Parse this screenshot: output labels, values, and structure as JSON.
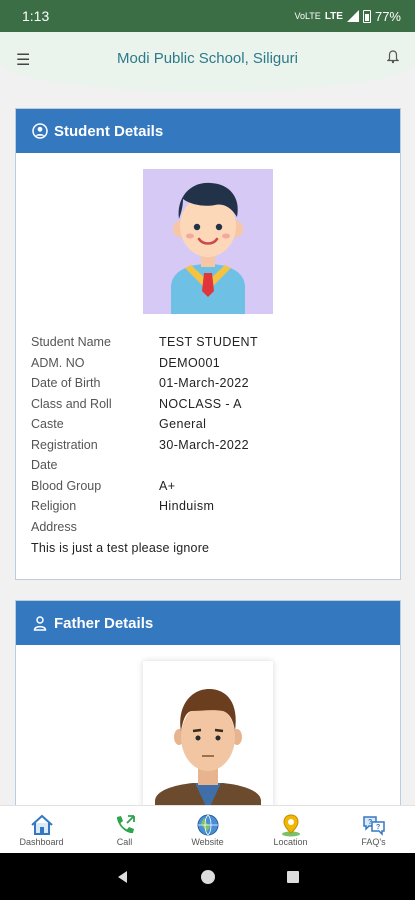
{
  "status_bar": {
    "time": "1:13",
    "network_top": "VoLTE",
    "network_bottom": "LTE",
    "battery": "77%"
  },
  "header": {
    "title": "Modi Public School, Siliguri"
  },
  "student_card": {
    "title": "Student Details",
    "fields": [
      {
        "label": "Student Name",
        "value": "TEST STUDENT"
      },
      {
        "label": "ADM. NO",
        "value": "DEMO001"
      },
      {
        "label": "Date of Birth",
        "value": "01-March-2022"
      },
      {
        "label": "Class and Roll",
        "value": "NOCLASS - A"
      },
      {
        "label": "Caste",
        "value": "General"
      },
      {
        "label": "Registration Date",
        "value": "30-March-2022"
      },
      {
        "label": "Blood Group",
        "value": "A+"
      },
      {
        "label": "Religion",
        "value": "Hinduism"
      },
      {
        "label": "Address",
        "value": ""
      }
    ],
    "address": "This is just a test please ignore"
  },
  "father_card": {
    "title": "Father Details"
  },
  "bottom_nav": [
    {
      "label": "Dashboard",
      "icon": "home-icon"
    },
    {
      "label": "Call",
      "icon": "phone-icon"
    },
    {
      "label": "Website",
      "icon": "globe-icon"
    },
    {
      "label": "Location",
      "icon": "location-pin-icon"
    },
    {
      "label": "FAQ's",
      "icon": "faq-chat-icon"
    }
  ],
  "colors": {
    "status_bar": "#3b6e44",
    "card_header": "#3478c0",
    "header_title": "#2d7a8a"
  }
}
